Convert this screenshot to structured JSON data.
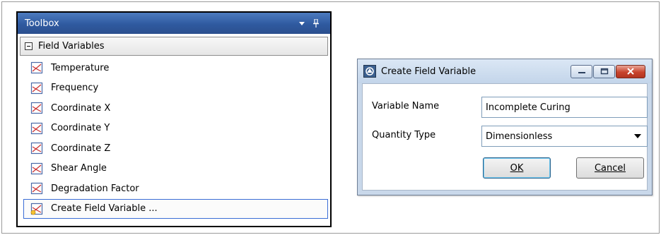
{
  "toolbox": {
    "title": "Toolbox",
    "header_icons": [
      "dropdown-arrow-icon",
      "pin-icon"
    ],
    "group": {
      "label": "Field Variables",
      "expanded": true,
      "items": [
        {
          "label": "Temperature",
          "icon": "field-variable-icon"
        },
        {
          "label": "Frequency",
          "icon": "field-variable-icon"
        },
        {
          "label": "Coordinate X",
          "icon": "field-variable-icon"
        },
        {
          "label": "Coordinate Y",
          "icon": "field-variable-icon"
        },
        {
          "label": "Coordinate Z",
          "icon": "field-variable-icon"
        },
        {
          "label": "Shear Angle",
          "icon": "field-variable-icon"
        },
        {
          "label": "Degradation Factor",
          "icon": "field-variable-icon"
        },
        {
          "label": "Create Field Variable ...",
          "icon": "create-field-variable-icon",
          "selected": true
        }
      ]
    }
  },
  "dialog": {
    "title": "Create Field Variable",
    "app_icon": "app-icon",
    "window_buttons": [
      "minimize-icon",
      "maximize-icon",
      "close-icon"
    ],
    "variable_name_label": "Variable Name",
    "variable_name_value": "Incomplete Curing",
    "quantity_type_label": "Quantity Type",
    "quantity_type_value": "Dimensionless",
    "ok_label": "OK",
    "cancel_label": "Cancel"
  },
  "colors": {
    "toolbox_header": "#2f5aa0",
    "dialog_frame": "#c9d8ea",
    "close_button": "#c8432c",
    "selection_border": "#3a6dd6"
  }
}
